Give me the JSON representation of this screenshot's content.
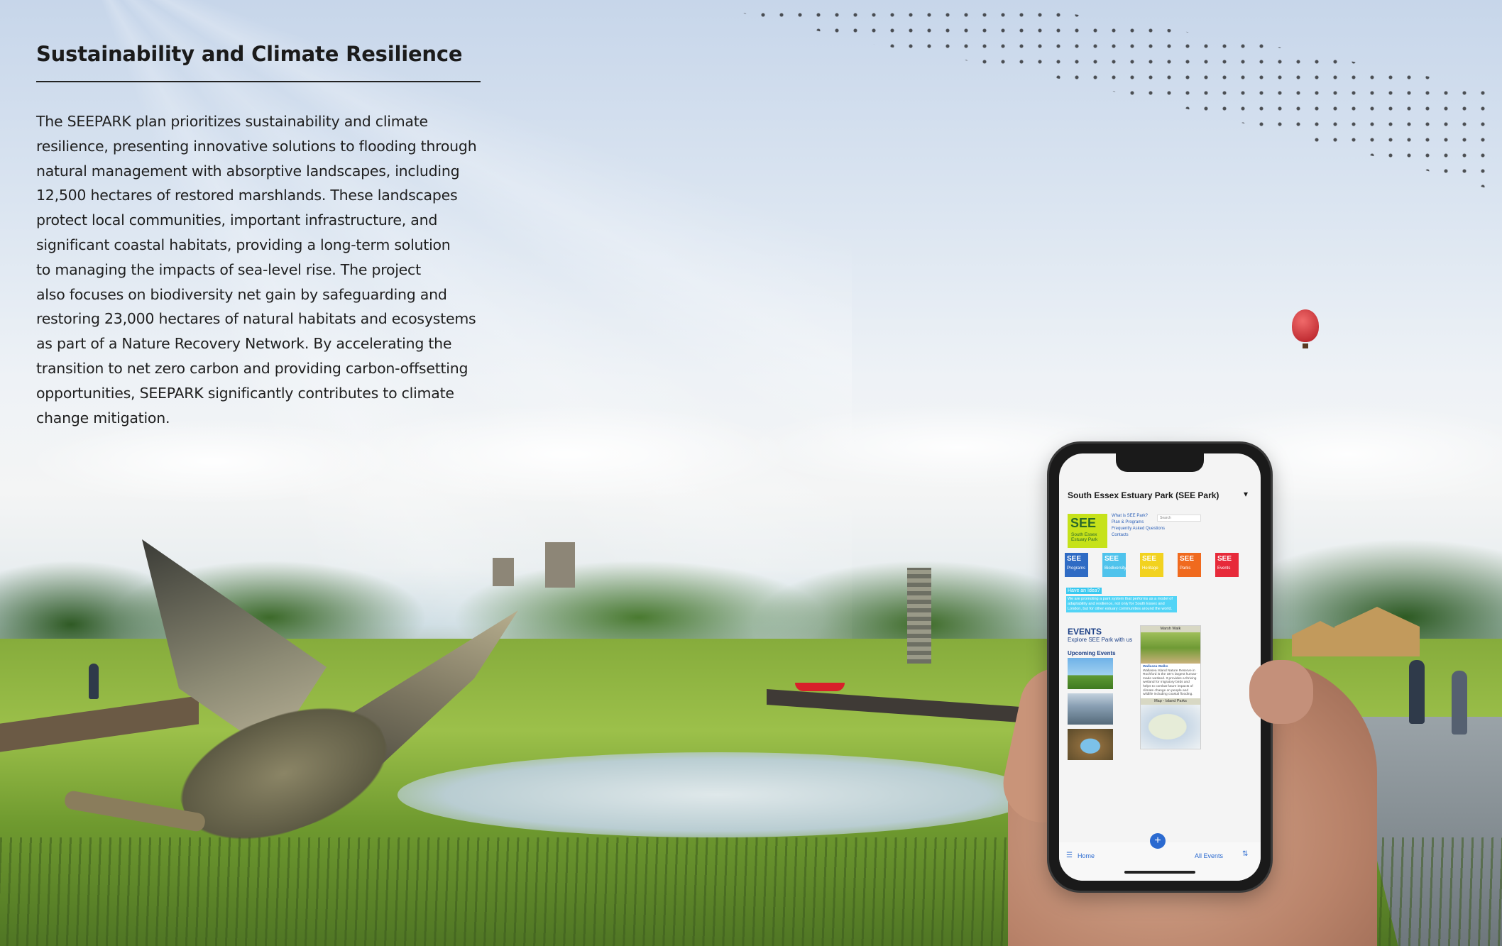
{
  "article": {
    "heading": "Sustainability and Climate Resilience",
    "lines": [
      "The SEEPARK plan prioritizes sustainability and climate",
      "resilience, presenting innovative solutions to flooding through",
      "natural management with absorptive landscapes, including",
      "12,500 hectares of restored marshlands. These landscapes",
      "protect local communities, important infrastructure, and",
      "significant coastal habitats, providing a long-term solution",
      "to managing the impacts of sea-level rise. The project",
      "also focuses on biodiversity net gain by safeguarding and",
      "restoring 23,000 hectares of natural habitats and ecosystems",
      "as part of a Nature Recovery Network. By accelerating the",
      "transition to net zero carbon and providing carbon-offsetting",
      "opportunities, SEEPARK significantly contributes to climate",
      "change mitigation."
    ]
  },
  "phone_app": {
    "title": "South Essex Estuary Park (SEE Park)",
    "logo": {
      "main": "SEE",
      "sub": "South Essex Estuary Park"
    },
    "nav": [
      "What is SEE Park?",
      "Plan & Programs",
      "Frequently Asked Questions",
      "Contacts"
    ],
    "search_placeholder": "Search",
    "tiles": [
      {
        "top": "SEE",
        "bottom": "Programs",
        "color": "#2f6bc4"
      },
      {
        "top": "SEE",
        "bottom": "Biodiversity",
        "color": "#4fc3ec"
      },
      {
        "top": "SEE",
        "bottom": "Heritage",
        "color": "#f2d21f"
      },
      {
        "top": "SEE",
        "bottom": "Parks",
        "color": "#f06a1e"
      },
      {
        "top": "SEE",
        "bottom": "Events",
        "color": "#e72a3a"
      }
    ],
    "idea_label": "Have an Idea?",
    "idea_text": "We are promoting a park system that performs as a model of adaptability and resilience, not only for South Essex and London, but for other estuary communities around the world.",
    "events_heading": "EVENTS",
    "events_sub": "Explore SEE Park with us",
    "upcoming": "Upcoming Events",
    "card1_caption": "Marsh Walk",
    "card1_title": "Wallasea Walks",
    "card1_text": "Wallasea Island Nature Reserve in Rochford is the UK's largest human-made wetland. It provides a thriving wetland for migratory birds and helps to combat future impacts of climate change on people and wildlife including coastal flooding.",
    "card2_caption": "Map - Island Parks",
    "home_label": "Home",
    "all_events_label": "All Events",
    "icons": {
      "home": "sliders-icon",
      "add": "plus-icon",
      "sort": "sort-az-icon"
    },
    "accent": "#2b6ad0"
  }
}
